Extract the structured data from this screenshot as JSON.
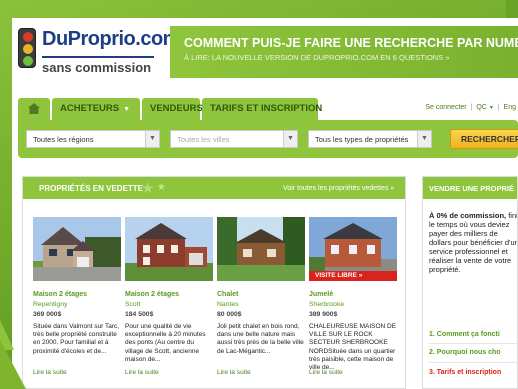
{
  "header": {
    "logo_name": "DuProprio.com",
    "logo_sub": "sans commission",
    "promo_title": "COMMENT PUIS-JE FAIRE UNE RECHERCHE PAR NUMÉRO DE TÉLÉP",
    "promo_sub": "À LIRE: LA NOUVELLE VERSION DE DUPROPRIO.COM EN 6 QUESTIONS »"
  },
  "nav": {
    "tabs": [
      {
        "label": "ACHETEURS"
      },
      {
        "label": "VENDEURS"
      },
      {
        "label": "TARIFS ET INSCRIPTION"
      }
    ],
    "connect": "Se connecter",
    "province": "QC",
    "language": "Eng"
  },
  "search": {
    "regions": "Toutes les régions",
    "cities": "Toutes les villes",
    "types": "Tous les types de propriétés",
    "button": "RECHERCHER"
  },
  "featured": {
    "title": "PROPRIÉTÉS EN VEDETTE",
    "see_all": "Voir toutes les propriétés vedettes »",
    "cards": [
      {
        "type": "Maison 2 étages",
        "city": "Repentigny",
        "price": "369 000$",
        "desc": "Située dans Valmont sur Tarc, très belle propriété construite en 2000. Pour familial et à proximité d'écoles et de...",
        "more": "Lire la suite"
      },
      {
        "type": "Maison 2 étages",
        "city": "Scott",
        "price": "184 500$",
        "desc": "Pour une qualité de vie exceptionnelle à 20 minutes des ponts (Au centre du village de Scott, ancienne maison de...",
        "more": "Lire la suite"
      },
      {
        "type": "Chalet",
        "city": "Nantes",
        "price": "80 000$",
        "desc": "Joli petit chalet en bois rond, dans une belle nature mais aussi très près de la belle ville de Lac-Mégantic...",
        "more": "Lire la suite"
      },
      {
        "type": "Jumelé",
        "city": "Sherbrooke",
        "price": "389 900$",
        "desc": "CHALEUREUSE MAISON DE VILLE SUR LE ROCK SECTEUR SHERBROOKE NORDSituée dans un quartier très paisible, cette maison de ville de...",
        "more": "Lire la suite",
        "badge": "VISITE LIBRE"
      }
    ]
  },
  "sell": {
    "title": "VENDRE UNE PROPRIÉ",
    "intro_bold": "À 0% de commission,",
    "intro": "fini le temps où vous deviez payer des milliers de dollars pour bénéficier d'un service professionnel et réaliser la vente de votre propriété.",
    "links": [
      "1. Comment ça foncti",
      "2. Pourquoi nous cho",
      "3. Tarifs et inscription"
    ]
  },
  "colors": {
    "brand_green": "#8ec53c",
    "brand_blue": "#1d3e85",
    "accent_red": "#d8241c",
    "button_yellow": "#f0b21e"
  }
}
